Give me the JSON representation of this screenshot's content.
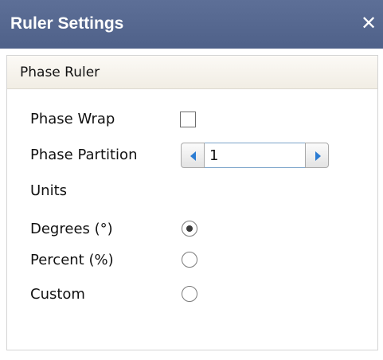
{
  "window": {
    "title": "Ruler Settings",
    "close_symbol": "✕",
    "titlebar_color": "#56688f"
  },
  "panel": {
    "title": "Phase Ruler",
    "phase_wrap": {
      "label": "Phase Wrap",
      "checked": false
    },
    "phase_partition": {
      "label": "Phase Partition",
      "value": "1",
      "decrement_icon": "triangle-left-icon",
      "increment_icon": "triangle-right-icon",
      "arrow_color": "#2b7cd3"
    },
    "units": {
      "label": "Units",
      "options": [
        {
          "label": "Degrees (°)",
          "selected": true
        },
        {
          "label": "Percent (%)",
          "selected": false
        },
        {
          "label": "Custom",
          "selected": false
        }
      ]
    }
  }
}
